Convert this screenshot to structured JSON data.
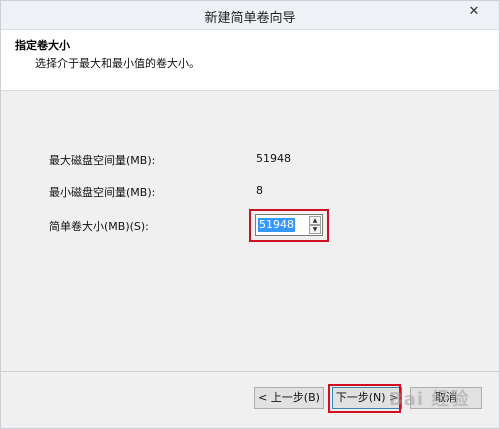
{
  "window": {
    "title": "新建简单卷向导",
    "close_glyph": "✕"
  },
  "header": {
    "title": "指定卷大小",
    "subtitle": "选择介于最大和最小值的卷大小。"
  },
  "fields": {
    "max_label": "最大磁盘空间量(MB):",
    "max_value": "51948",
    "min_label": "最小磁盘空间量(MB):",
    "min_value": "8",
    "size_label": "简单卷大小(MB)(S):",
    "size_value": "51948"
  },
  "buttons": {
    "back": "< 上一步(B)",
    "next": "下一步(N) >",
    "cancel": "取消"
  },
  "watermark": {
    "text": "Bai 经验"
  },
  "colors": {
    "highlight_box": "#d01020",
    "selection": "#3399ff"
  }
}
